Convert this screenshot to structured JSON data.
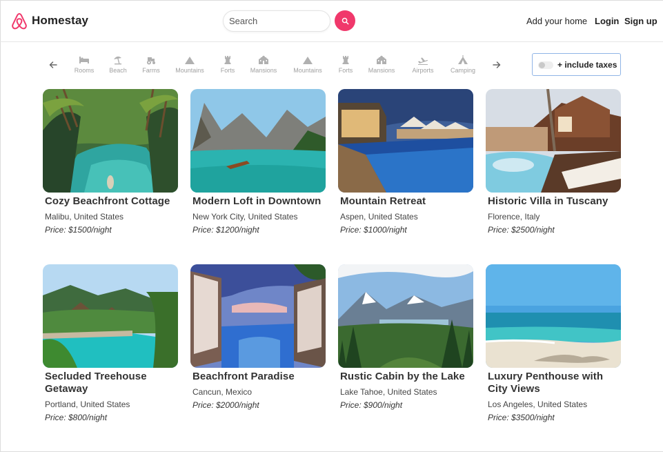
{
  "header": {
    "brand": "Homestay",
    "search_placeholder": "Search",
    "add_home": "Add your home",
    "login": "Login",
    "signup": "Sign up",
    "accent_color": "#f0386b"
  },
  "categories": [
    {
      "label": "Rooms",
      "icon": "bed-icon"
    },
    {
      "label": "Beach",
      "icon": "beach-umbrella-icon"
    },
    {
      "label": "Farms",
      "icon": "tractor-icon"
    },
    {
      "label": "Mountains",
      "icon": "mountain-icon"
    },
    {
      "label": "Forts",
      "icon": "rook-icon"
    },
    {
      "label": "Mansions",
      "icon": "mansion-icon"
    },
    {
      "label": "Mountains",
      "icon": "mountain-icon"
    },
    {
      "label": "Forts",
      "icon": "rook-icon"
    },
    {
      "label": "Mansions",
      "icon": "mansion-icon"
    },
    {
      "label": "Airports",
      "icon": "airplane-icon"
    },
    {
      "label": "Camping",
      "icon": "tent-icon"
    }
  ],
  "taxes_toggle": {
    "label": "+ include taxes",
    "on": false
  },
  "listings": [
    {
      "title": "Cozy Beachfront Cottage",
      "location": "Malibu, United States",
      "price": "Price: $1500/night",
      "image": "tropical-lagoon-palms"
    },
    {
      "title": "Modern Loft in Downtown",
      "location": "New York City, United States",
      "price": "Price: $1200/night",
      "image": "mountain-lake-boat"
    },
    {
      "title": "Mountain Retreat",
      "location": "Aspen, United States",
      "price": "Price: $1000/night",
      "image": "resort-pool-dusk"
    },
    {
      "title": "Historic Villa in Tuscany",
      "location": "Florence, Italy",
      "price": "Price: $2500/night",
      "image": "villa-pool-loungers"
    },
    {
      "title": "Secluded Treehouse Getaway",
      "location": "Portland, United States",
      "price": "Price: $800/night",
      "image": "tropical-resort-pool"
    },
    {
      "title": "Beachfront Paradise",
      "location": "Cancun, Mexico",
      "price": "Price: $2000/night",
      "image": "cabana-infinity-pool"
    },
    {
      "title": "Rustic Cabin by the Lake",
      "location": "Lake Tahoe, United States",
      "price": "Price: $900/night",
      "image": "pine-forest-mountains"
    },
    {
      "title": "Luxury Penthouse with City Views",
      "location": "Los Angeles, United States",
      "price": "Price: $3500/night",
      "image": "turquoise-beach"
    }
  ]
}
